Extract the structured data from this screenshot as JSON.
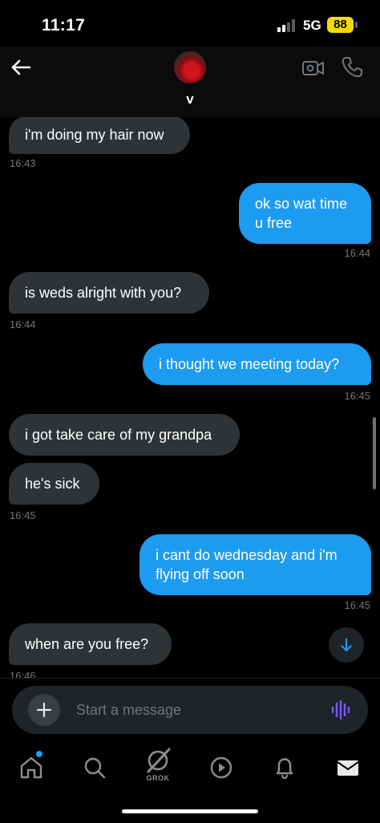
{
  "status_bar": {
    "time": "11:17",
    "network": "5G",
    "battery": "88"
  },
  "header": {
    "contact_name": "v",
    "icons": [
      "back-arrow-icon",
      "video-camera-icon",
      "phone-icon"
    ]
  },
  "messages": [
    {
      "sender": "them",
      "text": "i'm doing my hair now",
      "time": "16:43"
    },
    {
      "sender": "me",
      "text": "ok so wat time u free",
      "time": "16:44"
    },
    {
      "sender": "them",
      "text": "is weds alright with you?",
      "time": "16:44"
    },
    {
      "sender": "me",
      "text": "i thought we meeting today?",
      "time": "16:45"
    },
    {
      "sender": "them",
      "text": "i got take care of my grandpa",
      "time": ""
    },
    {
      "sender": "them",
      "text": "he's sick",
      "time": "16:45"
    },
    {
      "sender": "me",
      "text": "i cant do wednesday and i'm flying off soon",
      "time": "16:45"
    },
    {
      "sender": "them",
      "text": "when are you free?",
      "time": "16:46"
    }
  ],
  "composer": {
    "placeholder": "Start a message"
  },
  "nav": {
    "items": [
      "home-icon",
      "search-icon",
      "grok-icon",
      "video-play-icon",
      "notifications-bell-icon",
      "messages-envelope-icon"
    ],
    "grok_label": "GROK"
  },
  "colors": {
    "background": "#000000",
    "incoming_bubble": "#2f3336",
    "outgoing_bubble": "#1d9bf0",
    "timestamp": "#71767b",
    "battery": "#f5d90a",
    "voice_accent": "#7856ff"
  }
}
